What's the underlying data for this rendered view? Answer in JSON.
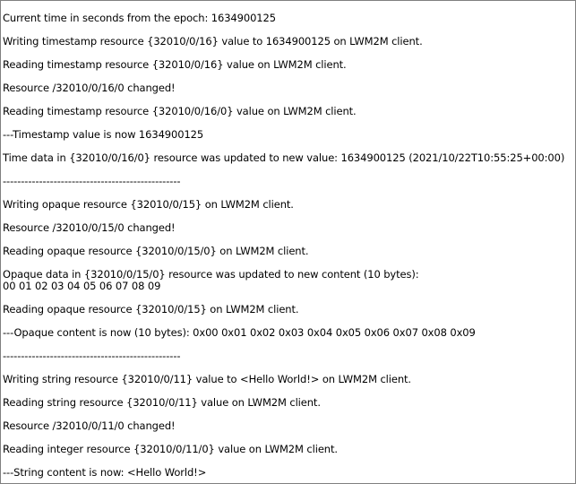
{
  "log_lines": [
    "Current time in seconds from the epoch: 1634900125",
    "Writing timestamp resource {32010/0/16} value to 1634900125 on LWM2M client.",
    "Reading timestamp resource {32010/0/16} value on LWM2M client.",
    "Resource /32010/0/16/0 changed!",
    "Reading timestamp resource {32010/0/16/0} value on LWM2M client.",
    "---Timestamp value is now 1634900125",
    "Time data in {32010/0/16/0} resource was updated to new value: 1634900125 (2021/10/22T10:55:25+00:00)",
    "-------------------------------------------------",
    "Writing opaque resource {32010/0/15} on LWM2M client.",
    "Resource /32010/0/15/0 changed!",
    "Reading opaque resource {32010/0/15/0} on LWM2M client.",
    "Opaque data in {32010/0/15/0} resource was updated to new content (10 bytes):",
    "00 01 02 03 04 05 06 07 08 09",
    "Reading opaque resource {32010/0/15} on LWM2M client.",
    "---Opaque content is now (10 bytes): 0x00 0x01 0x02 0x03 0x04 0x05 0x06 0x07 0x08 0x09",
    "-------------------------------------------------",
    "Writing string resource {32010/0/11} value to <Hello World!> on LWM2M client.",
    "Reading string resource {32010/0/11} value on LWM2M client.",
    "Resource /32010/0/11/0 changed!",
    "Reading integer resource {32010/0/11/0} value on LWM2M client.",
    "---String content is now: <Hello World!>"
  ]
}
